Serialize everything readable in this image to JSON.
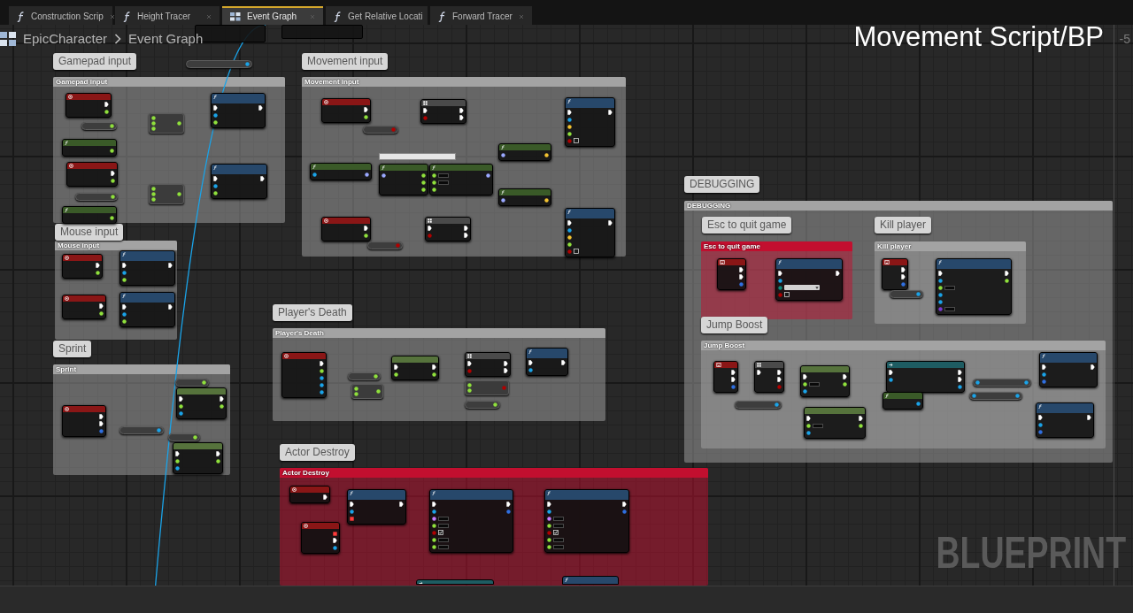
{
  "tabs": [
    {
      "label": "Construction Scrip",
      "kind": "function",
      "selected": false
    },
    {
      "label": "Height Tracer",
      "kind": "function",
      "selected": false
    },
    {
      "label": "Event Graph",
      "kind": "graph",
      "selected": true
    },
    {
      "label": "Get Relative Locati",
      "kind": "function",
      "selected": false
    },
    {
      "label": "Forward Tracer",
      "kind": "function",
      "selected": false
    }
  ],
  "breadcrumb": {
    "items": [
      "EpicCharacter",
      "Event Graph"
    ]
  },
  "graph": {
    "title": "Movement Script/BP",
    "zoom": "-5",
    "loose_nodes": [
      {
        "kind": "fragment"
      },
      {
        "kind": "fragment"
      },
      {
        "kind": "variable",
        "outputs": [
          {
            "kind": "object"
          }
        ]
      }
    ],
    "comments": [
      {
        "bubble": "Gamepad input",
        "title": "Gamepad input",
        "color": "#a3a3a3",
        "nodes": [
          {
            "kind": "event",
            "outputs": [
              {
                "kind": "exec"
              },
              {
                "kind": "float"
              }
            ]
          },
          {
            "kind": "variable",
            "outputs": [
              {
                "kind": "float"
              }
            ]
          },
          {
            "kind": "pure",
            "outputs": [
              {
                "kind": "float"
              }
            ]
          },
          {
            "kind": "operator",
            "inputs": [
              {
                "kind": "float"
              },
              {
                "kind": "float"
              },
              {
                "kind": "float"
              }
            ],
            "outputs": [
              {
                "kind": "float"
              }
            ]
          },
          {
            "kind": "function",
            "inputs": [
              {
                "kind": "exec"
              },
              {
                "kind": "object"
              },
              {
                "kind": "float"
              }
            ],
            "outputs": [
              {
                "kind": "exec"
              }
            ]
          },
          {
            "kind": "event",
            "outputs": [
              {
                "kind": "exec"
              },
              {
                "kind": "float"
              }
            ]
          },
          {
            "kind": "variable",
            "outputs": [
              {
                "kind": "float"
              }
            ]
          },
          {
            "kind": "pure",
            "outputs": [
              {
                "kind": "float"
              }
            ]
          },
          {
            "kind": "operator",
            "inputs": [
              {
                "kind": "float"
              },
              {
                "kind": "float"
              },
              {
                "kind": "float"
              }
            ],
            "outputs": [
              {
                "kind": "float"
              }
            ]
          },
          {
            "kind": "function",
            "inputs": [
              {
                "kind": "exec"
              },
              {
                "kind": "object"
              },
              {
                "kind": "float"
              }
            ],
            "outputs": [
              {
                "kind": "exec"
              }
            ]
          }
        ]
      },
      {
        "bubble": "Movement input",
        "title": "Movement input",
        "color": "#a3a3a3",
        "nodes": [
          {
            "kind": "event",
            "outputs": [
              {
                "kind": "exec"
              },
              {
                "kind": "float"
              }
            ]
          },
          {
            "kind": "macro",
            "inputs": [
              {
                "kind": "exec"
              },
              {
                "kind": "bool"
              }
            ],
            "outputs": [
              {
                "kind": "exec"
              },
              {
                "kind": "exec"
              }
            ]
          },
          {
            "kind": "variable",
            "outputs": [
              {
                "kind": "bool"
              }
            ]
          },
          {
            "kind": "function",
            "inputs": [
              {
                "kind": "exec"
              },
              {
                "kind": "object"
              },
              {
                "kind": "vector"
              },
              {
                "kind": "float"
              },
              {
                "kind": "bool",
                "checked": false
              }
            ],
            "outputs": [
              {
                "kind": "exec"
              }
            ]
          },
          {
            "kind": "note"
          },
          {
            "kind": "pure",
            "inputs": [
              {
                "kind": "object"
              }
            ],
            "outputs": [
              {
                "kind": "rotator"
              }
            ]
          },
          {
            "kind": "pure",
            "inputs": [
              {
                "kind": "rotator"
              }
            ],
            "outputs": [
              {
                "kind": "float"
              },
              {
                "kind": "float"
              },
              {
                "kind": "float"
              }
            ]
          },
          {
            "kind": "pure",
            "inputs": [
              {
                "kind": "float",
                "field": true
              },
              {
                "kind": "float",
                "field": true
              },
              {
                "kind": "float"
              }
            ],
            "outputs": [
              {
                "kind": "rotator"
              }
            ]
          },
          {
            "kind": "pure",
            "inputs": [
              {
                "kind": "rotator"
              }
            ],
            "outputs": [
              {
                "kind": "vector"
              }
            ]
          },
          {
            "kind": "pure",
            "inputs": [
              {
                "kind": "rotator"
              }
            ],
            "outputs": [
              {
                "kind": "vector"
              }
            ]
          },
          {
            "kind": "event",
            "outputs": [
              {
                "kind": "exec"
              },
              {
                "kind": "float"
              }
            ]
          },
          {
            "kind": "macro",
            "inputs": [
              {
                "kind": "exec"
              },
              {
                "kind": "bool"
              }
            ],
            "outputs": [
              {
                "kind": "exec"
              },
              {
                "kind": "exec"
              }
            ]
          },
          {
            "kind": "variable",
            "outputs": [
              {
                "kind": "bool"
              }
            ]
          },
          {
            "kind": "function",
            "inputs": [
              {
                "kind": "exec"
              },
              {
                "kind": "object"
              },
              {
                "kind": "vector"
              },
              {
                "kind": "float"
              },
              {
                "kind": "bool",
                "checked": false
              }
            ],
            "outputs": [
              {
                "kind": "exec"
              }
            ]
          }
        ]
      },
      {
        "bubble": "DEBUGGING",
        "title": "DEBUGGING",
        "color": "#a3a3a3",
        "children": [
          {
            "bubble": "Esc to quit game",
            "title": "Esc to quit game",
            "color": "#c20f2f",
            "nodes": [
              {
                "kind": "key_event",
                "outputs": [
                  {
                    "kind": "exec"
                  },
                  {
                    "kind": "exec"
                  },
                  {
                    "kind": "struct"
                  }
                ]
              },
              {
                "kind": "function",
                "inputs": [
                  {
                    "kind": "exec"
                  },
                  {
                    "kind": "object"
                  },
                  {
                    "kind": "enum",
                    "dropdown": true
                  },
                  {
                    "kind": "bool",
                    "checked": false
                  }
                ],
                "outputs": [
                  {
                    "kind": "exec"
                  }
                ]
              }
            ]
          },
          {
            "bubble": "Kill player",
            "title": "Kill player",
            "color": "#a3a3a3",
            "nodes": [
              {
                "kind": "key_event",
                "outputs": [
                  {
                    "kind": "exec"
                  },
                  {
                    "kind": "exec"
                  },
                  {
                    "kind": "struct"
                  }
                ]
              },
              {
                "kind": "variable",
                "outputs": [
                  {
                    "kind": "object"
                  }
                ]
              },
              {
                "kind": "function",
                "inputs": [
                  {
                    "kind": "exec"
                  },
                  {
                    "kind": "object"
                  },
                  {
                    "kind": "float",
                    "field": true
                  },
                  {
                    "kind": "object"
                  },
                  {
                    "kind": "object"
                  },
                  {
                    "kind": "class",
                    "field": true
                  }
                ],
                "outputs": [
                  {
                    "kind": "exec"
                  },
                  {
                    "kind": "float"
                  }
                ]
              }
            ]
          },
          {
            "bubble": "Jump Boost",
            "title": "Jump Boost",
            "color": "#a3a3a3",
            "nodes": [
              {
                "kind": "key_event",
                "outputs": [
                  {
                    "kind": "exec"
                  },
                  {
                    "kind": "exec"
                  },
                  {
                    "kind": "struct"
                  }
                ]
              },
              {
                "kind": "macro",
                "inputs": [
                  {
                    "kind": "exec"
                  }
                ],
                "outputs": [
                  {
                    "kind": "exec"
                  },
                  {
                    "kind": "exec"
                  },
                  {
                    "kind": "bool"
                  }
                ]
              },
              {
                "kind": "set",
                "inputs": [
                  {
                    "kind": "exec"
                  },
                  {
                    "kind": "float",
                    "field": true
                  },
                  {
                    "kind": "object"
                  }
                ],
                "outputs": [
                  {
                    "kind": "exec"
                  },
                  {
                    "kind": "float"
                  }
                ]
              },
              {
                "kind": "variable",
                "outputs": [
                  {
                    "kind": "object"
                  }
                ]
              },
              {
                "kind": "set",
                "inputs": [
                  {
                    "kind": "exec"
                  },
                  {
                    "kind": "float",
                    "field": true
                  },
                  {
                    "kind": "object"
                  }
                ],
                "outputs": [
                  {
                    "kind": "exec"
                  },
                  {
                    "kind": "float"
                  }
                ]
              },
              {
                "kind": "cast",
                "inputs": [
                  {
                    "kind": "exec"
                  },
                  {
                    "kind": "object"
                  }
                ],
                "outputs": [
                  {
                    "kind": "exec"
                  },
                  {
                    "kind": "exec"
                  },
                  {
                    "kind": "object"
                  }
                ]
              },
              {
                "kind": "pure",
                "outputs": [
                  {
                    "kind": "object"
                  }
                ]
              },
              {
                "kind": "getter",
                "inputs": [
                  {
                    "kind": "object"
                  }
                ],
                "outputs": [
                  {
                    "kind": "object"
                  }
                ]
              },
              {
                "kind": "getter",
                "inputs": [
                  {
                    "kind": "object"
                  }
                ],
                "outputs": [
                  {
                    "kind": "object"
                  }
                ]
              },
              {
                "kind": "function",
                "inputs": [
                  {
                    "kind": "exec"
                  },
                  {
                    "kind": "object"
                  },
                  {
                    "kind": "color"
                  }
                ],
                "outputs": [
                  {
                    "kind": "exec"
                  }
                ]
              },
              {
                "kind": "function",
                "inputs": [
                  {
                    "kind": "exec"
                  },
                  {
                    "kind": "object"
                  },
                  {
                    "kind": "color"
                  }
                ],
                "outputs": [
                  {
                    "kind": "exec"
                  }
                ]
              }
            ]
          }
        ]
      },
      {
        "bubble": "Mouse input",
        "title": "Mouse input",
        "color": "#a3a3a3",
        "nodes": [
          {
            "kind": "event",
            "outputs": [
              {
                "kind": "exec"
              },
              {
                "kind": "float"
              }
            ]
          },
          {
            "kind": "function",
            "inputs": [
              {
                "kind": "exec"
              },
              {
                "kind": "object"
              },
              {
                "kind": "float"
              }
            ],
            "outputs": [
              {
                "kind": "exec"
              }
            ]
          },
          {
            "kind": "event",
            "outputs": [
              {
                "kind": "exec"
              },
              {
                "kind": "float"
              }
            ]
          },
          {
            "kind": "function",
            "inputs": [
              {
                "kind": "exec"
              },
              {
                "kind": "object"
              },
              {
                "kind": "float"
              }
            ],
            "outputs": [
              {
                "kind": "exec"
              }
            ]
          }
        ]
      },
      {
        "bubble": "Player's Death",
        "title": "Player's Death",
        "color": "#a3a3a3",
        "nodes": [
          {
            "kind": "event",
            "outputs": [
              {
                "kind": "exec"
              },
              {
                "kind": "float"
              },
              {
                "kind": "object"
              },
              {
                "kind": "object"
              },
              {
                "kind": "object"
              }
            ]
          },
          {
            "kind": "variable",
            "outputs": [
              {
                "kind": "float"
              }
            ]
          },
          {
            "kind": "operator",
            "inputs": [
              {
                "kind": "float"
              },
              {
                "kind": "float"
              }
            ],
            "outputs": [
              {
                "kind": "float"
              }
            ]
          },
          {
            "kind": "set",
            "inputs": [
              {
                "kind": "exec"
              },
              {
                "kind": "float"
              }
            ],
            "outputs": [
              {
                "kind": "exec"
              },
              {
                "kind": "float"
              }
            ]
          },
          {
            "kind": "macro",
            "inputs": [
              {
                "kind": "exec"
              },
              {
                "kind": "bool"
              }
            ],
            "outputs": [
              {
                "kind": "exec"
              },
              {
                "kind": "exec"
              }
            ]
          },
          {
            "kind": "operator",
            "inputs": [
              {
                "kind": "float"
              },
              {
                "kind": "float"
              }
            ],
            "outputs": [
              {
                "kind": "bool"
              }
            ]
          },
          {
            "kind": "variable",
            "outputs": [
              {
                "kind": "float"
              }
            ]
          },
          {
            "kind": "function",
            "inputs": [
              {
                "kind": "exec"
              },
              {
                "kind": "object"
              }
            ],
            "outputs": [
              {
                "kind": "exec"
              }
            ]
          }
        ]
      },
      {
        "bubble": "Sprint",
        "title": "Sprint",
        "color": "#a3a3a3",
        "nodes": [
          {
            "kind": "event",
            "outputs": [
              {
                "kind": "exec"
              },
              {
                "kind": "exec"
              },
              {
                "kind": "struct"
              }
            ]
          },
          {
            "kind": "variable",
            "outputs": [
              {
                "kind": "float"
              }
            ]
          },
          {
            "kind": "set",
            "inputs": [
              {
                "kind": "exec"
              },
              {
                "kind": "float"
              },
              {
                "kind": "object"
              }
            ],
            "outputs": [
              {
                "kind": "exec"
              },
              {
                "kind": "float"
              }
            ]
          },
          {
            "kind": "variable",
            "outputs": [
              {
                "kind": "object"
              }
            ]
          },
          {
            "kind": "variable",
            "outputs": [
              {
                "kind": "float"
              }
            ]
          },
          {
            "kind": "set",
            "inputs": [
              {
                "kind": "exec"
              },
              {
                "kind": "float"
              },
              {
                "kind": "object"
              }
            ],
            "outputs": [
              {
                "kind": "exec"
              },
              {
                "kind": "float"
              }
            ]
          }
        ]
      },
      {
        "bubble": "Actor Destroy",
        "title": "Actor Destroy",
        "color": "#c20f2f",
        "nodes": [
          {
            "kind": "event",
            "outputs": [
              {
                "kind": "exec"
              }
            ]
          },
          {
            "kind": "function",
            "inputs": [
              {
                "kind": "exec"
              },
              {
                "kind": "object"
              },
              {
                "kind": "delegate"
              }
            ],
            "outputs": [
              {
                "kind": "exec"
              }
            ]
          },
          {
            "kind": "event",
            "outputs": [
              {
                "kind": "delegate"
              },
              {
                "kind": "exec"
              },
              {
                "kind": "object"
              }
            ]
          },
          {
            "kind": "function",
            "inputs": [
              {
                "kind": "exec"
              },
              {
                "kind": "object"
              },
              {
                "kind": "name",
                "field": true
              },
              {
                "kind": "float",
                "field": true
              },
              {
                "kind": "bool",
                "checked": true
              },
              {
                "kind": "float",
                "field": true
              },
              {
                "kind": "float",
                "field": true
              }
            ],
            "outputs": [
              {
                "kind": "exec"
              },
              {
                "kind": "struct"
              }
            ]
          },
          {
            "kind": "function",
            "inputs": [
              {
                "kind": "exec"
              },
              {
                "kind": "object"
              },
              {
                "kind": "name",
                "field": true
              },
              {
                "kind": "float",
                "field": true
              },
              {
                "kind": "bool",
                "checked": true
              },
              {
                "kind": "float",
                "field": true
              },
              {
                "kind": "float",
                "field": true
              }
            ],
            "outputs": [
              {
                "kind": "exec"
              },
              {
                "kind": "struct"
              }
            ]
          },
          {
            "kind": "cast"
          },
          {
            "kind": "function"
          }
        ]
      }
    ],
    "watermark": "BLUEPRINT"
  }
}
